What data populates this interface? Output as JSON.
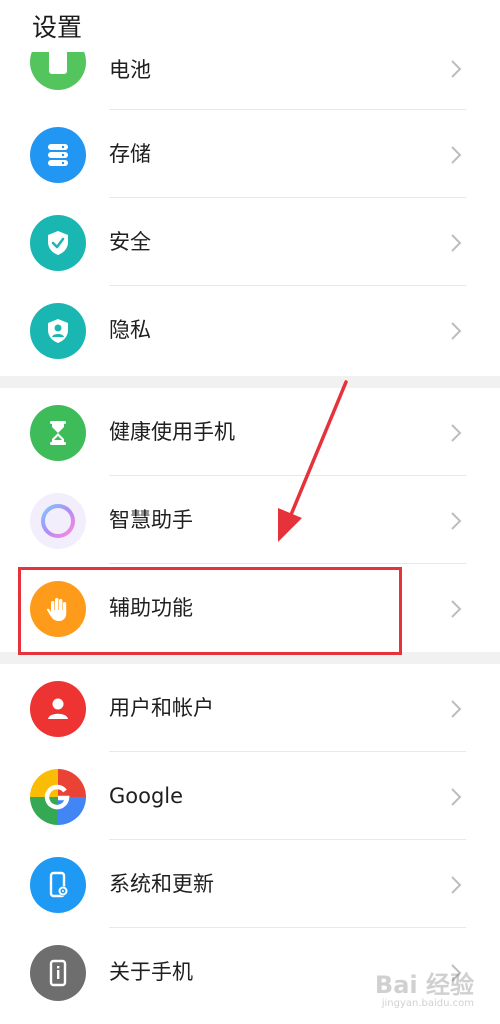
{
  "header": {
    "title": "设置"
  },
  "groups": [
    {
      "items": [
        {
          "label": "电池",
          "icon": "battery-icon",
          "color": "#54c45d"
        },
        {
          "label": "存储",
          "icon": "storage-icon",
          "color": "#2196f3"
        },
        {
          "label": "安全",
          "icon": "shield-icon",
          "color": "#1ab7b2"
        },
        {
          "label": "隐私",
          "icon": "privacy-icon",
          "color": "#1ab7b2"
        }
      ]
    },
    {
      "items": [
        {
          "label": "健康使用手机",
          "icon": "hourglass-icon",
          "color": "#3ebc59"
        },
        {
          "label": "智慧助手",
          "icon": "assistant-icon",
          "color": "#b08cf5"
        },
        {
          "label": "辅助功能",
          "icon": "hand-icon",
          "color": "#ff9b1a"
        }
      ]
    },
    {
      "items": [
        {
          "label": "用户和帐户",
          "icon": "user-icon",
          "color": "#ee3333"
        },
        {
          "label": "Google",
          "icon": "google-icon",
          "color": "#4285f4"
        },
        {
          "label": "系统和更新",
          "icon": "system-update-icon",
          "color": "#1e9af5"
        },
        {
          "label": "关于手机",
          "icon": "phone-info-icon",
          "color": "#6e6e6e"
        }
      ]
    }
  ],
  "annotation": {
    "highlight_color": "#e5323b",
    "highlighted_item": "辅助功能"
  },
  "watermark": {
    "main": "Bai 经验",
    "sub": "jingyan.baidu.com"
  }
}
